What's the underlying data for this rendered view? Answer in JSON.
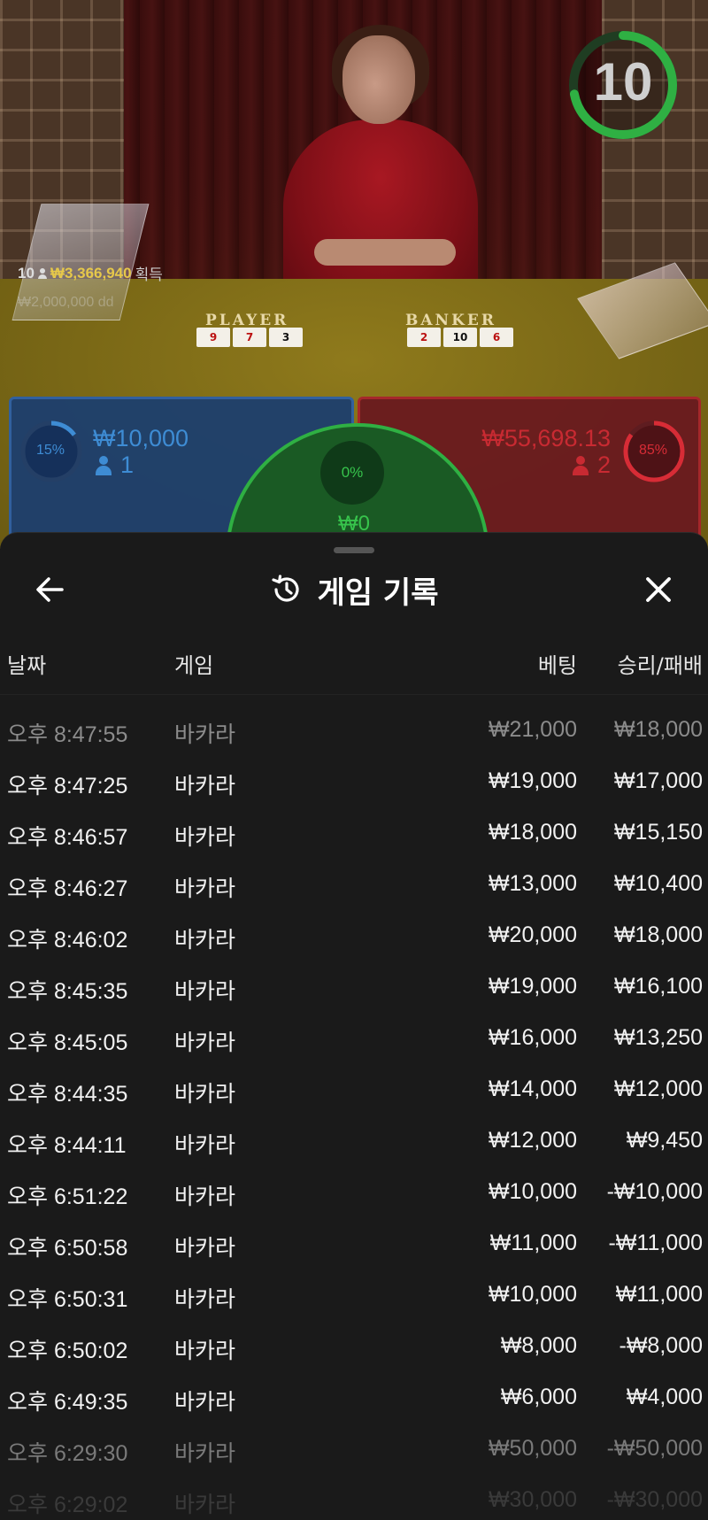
{
  "game": {
    "timer": "10",
    "timer_progress": 0.72,
    "winnings_count": "10",
    "winnings_amount": "₩3,366,940",
    "winnings_suffix": "획득",
    "ghost_text": "₩2,000,000 dd",
    "player_label": "PLAYER",
    "banker_label": "BANKER",
    "player_cards": [
      "9",
      "7",
      "3"
    ],
    "banker_cards": [
      "2",
      "10",
      "6"
    ],
    "player_bet": {
      "percent": "15%",
      "percent_value": 0.15,
      "amount": "₩10,000",
      "count": "1"
    },
    "banker_bet": {
      "percent": "85%",
      "percent_value": 0.85,
      "amount": "₩55,698.13",
      "count": "2"
    },
    "tie_bet": {
      "percent": "0%",
      "amount": "₩0"
    },
    "colors": {
      "player": "#2e60a6",
      "banker": "#a8242c",
      "tie": "#2fb043",
      "timer": "#2fb043"
    }
  },
  "history": {
    "title": "게임 기록",
    "back_icon": "arrow-left-icon",
    "close_icon": "close-icon",
    "title_icon": "history-icon",
    "columns": {
      "date": "날짜",
      "game": "게임",
      "bet": "베팅",
      "result": "승리/패배"
    },
    "rows": [
      {
        "date": "오후 8:47:55",
        "game": "바카라",
        "bet": "₩21,000",
        "result": "₩18,000"
      },
      {
        "date": "오후 8:47:25",
        "game": "바카라",
        "bet": "₩19,000",
        "result": "₩17,000"
      },
      {
        "date": "오후 8:46:57",
        "game": "바카라",
        "bet": "₩18,000",
        "result": "₩15,150"
      },
      {
        "date": "오후 8:46:27",
        "game": "바카라",
        "bet": "₩13,000",
        "result": "₩10,400"
      },
      {
        "date": "오후 8:46:02",
        "game": "바카라",
        "bet": "₩20,000",
        "result": "₩18,000"
      },
      {
        "date": "오후 8:45:35",
        "game": "바카라",
        "bet": "₩19,000",
        "result": "₩16,100"
      },
      {
        "date": "오후 8:45:05",
        "game": "바카라",
        "bet": "₩16,000",
        "result": "₩13,250"
      },
      {
        "date": "오후 8:44:35",
        "game": "바카라",
        "bet": "₩14,000",
        "result": "₩12,000"
      },
      {
        "date": "오후 8:44:11",
        "game": "바카라",
        "bet": "₩12,000",
        "result": "₩9,450"
      },
      {
        "date": "오후 6:51:22",
        "game": "바카라",
        "bet": "₩10,000",
        "result": "-₩10,000"
      },
      {
        "date": "오후 6:50:58",
        "game": "바카라",
        "bet": "₩11,000",
        "result": "-₩11,000"
      },
      {
        "date": "오후 6:50:31",
        "game": "바카라",
        "bet": "₩10,000",
        "result": "₩11,000"
      },
      {
        "date": "오후 6:50:02",
        "game": "바카라",
        "bet": "₩8,000",
        "result": "-₩8,000"
      },
      {
        "date": "오후 6:49:35",
        "game": "바카라",
        "bet": "₩6,000",
        "result": "₩4,000"
      },
      {
        "date": "오후 6:29:30",
        "game": "바카라",
        "bet": "₩50,000",
        "result": "-₩50,000"
      },
      {
        "date": "오후 6:29:02",
        "game": "바카라",
        "bet": "₩30,000",
        "result": "-₩30,000"
      }
    ]
  }
}
